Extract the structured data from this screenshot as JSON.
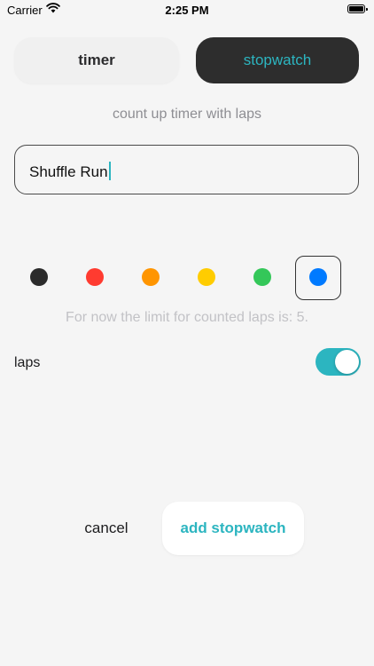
{
  "status_bar": {
    "carrier": "Carrier",
    "time": "2:25 PM"
  },
  "mode_tabs": {
    "timer_label": "timer",
    "stopwatch_label": "stopwatch",
    "selected": "stopwatch"
  },
  "subtitle": "count up timer with laps",
  "name_field": {
    "value": "Shuffle Run"
  },
  "colors": {
    "options": [
      "#2b2b2b",
      "#ff3b30",
      "#ff9500",
      "#ffcc00",
      "#34c759",
      "#007aff"
    ],
    "selected_index": 5
  },
  "limit_text": "For now the limit for counted laps is: 5.",
  "laps": {
    "label": "laps",
    "enabled": true
  },
  "actions": {
    "cancel_label": "cancel",
    "add_label": "add stopwatch"
  },
  "accent_color": "#2cb5c0"
}
